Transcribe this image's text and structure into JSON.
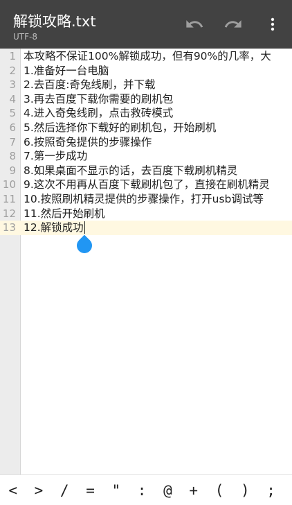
{
  "toolbar": {
    "title": "解锁攻略.txt",
    "encoding": "UTF-8",
    "undo_icon": "undo-icon",
    "redo_icon": "redo-icon",
    "menu_icon": "more-vert-icon"
  },
  "editor": {
    "line_numbers": [
      "1",
      "2",
      "3",
      "4",
      "5",
      "6",
      "7",
      "8",
      "9",
      "10",
      "11",
      "12",
      "13"
    ],
    "lines": [
      "本攻略不保证100%解锁成功，但有90%的几率，大",
      "1.准备好一台电脑",
      "2.去百度:奇兔线刷，并下载",
      "3.再去百度下载你需要的刷机包",
      "4.进入奇兔线刷，点击救砖模式",
      "5.然后选择你下载好的刷机包，开始刷机",
      "6.按照奇兔提供的步骤操作",
      "7.第一步成功",
      "8.如果桌面不显示的话，去百度下载刷机精灵",
      "9.这次不用再从百度下载刷机包了，直接在刷机精灵",
      "10.按照刷机精灵提供的步骤操作，打开usb调试等",
      "11.然后开始刷机",
      "12.解锁成功"
    ],
    "current_line": 13
  },
  "symbol_bar": {
    "keys": [
      "<",
      ">",
      "/",
      "=",
      "\"",
      ":",
      "@",
      "+",
      "(",
      ")",
      ";",
      ","
    ]
  },
  "colors": {
    "toolbar": "#424242",
    "gutter": "#ececec",
    "current_line": "#fff8e1",
    "caret_handle": "#2196f3"
  }
}
